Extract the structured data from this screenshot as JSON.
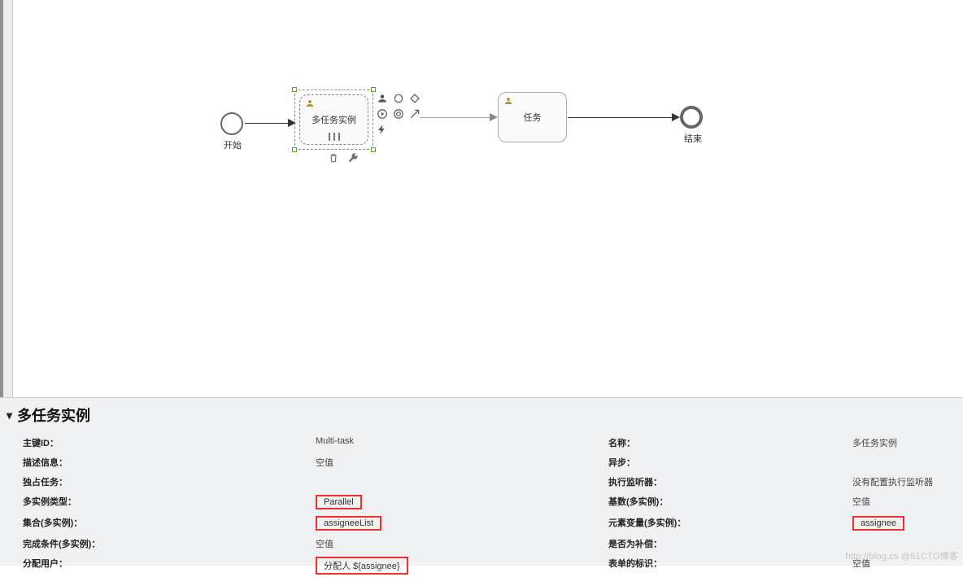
{
  "canvas": {
    "start_label": "开始",
    "end_label": "结束",
    "task1_label": "多任务实例",
    "task2_label": "任务"
  },
  "panel": {
    "title": "多任务实例",
    "rows": [
      {
        "l1": "主键ID：",
        "v1": "Multi-task",
        "l2": "名称：",
        "v2": "多任务实例"
      },
      {
        "l1": "描述信息：",
        "v1": "空值",
        "l2": "异步：",
        "v2": ""
      },
      {
        "l1": "独占任务：",
        "v1": "",
        "l2": "执行监听器：",
        "v2": "没有配置执行监听器"
      },
      {
        "l1": "多实例类型：",
        "v1": "Parallel",
        "hl1": true,
        "l2": "基数(多实例)：",
        "v2": "空值"
      },
      {
        "l1": "集合(多实例)：",
        "v1": "assigneeList",
        "hl1": true,
        "l2": "元素变量(多实例)：",
        "v2": "assignee",
        "hl2": true
      },
      {
        "l1": "完成条件(多实例)：",
        "v1": "空值",
        "l2": "是否为补偿：",
        "v2": ""
      },
      {
        "l1": "分配用户：",
        "v1": "分配人 ${assignee}",
        "hl1": true,
        "l2": "表单的标识：",
        "v2": "空值"
      }
    ]
  },
  "icons": {
    "user": "user-icon",
    "circle": "circle-icon",
    "diamond": "diamond-icon",
    "play": "play-icon",
    "target": "target-icon",
    "arrow": "arrow-icon",
    "bolt": "bolt-icon",
    "trash": "trash-icon",
    "wrench": "wrench-icon"
  },
  "watermark": "http://blog.cs @51CTO博客"
}
